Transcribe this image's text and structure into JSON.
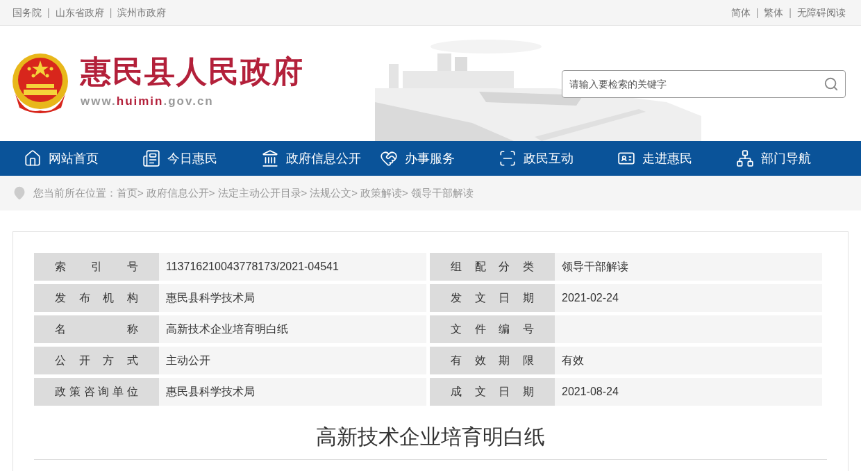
{
  "top_bar": {
    "left_links": [
      "国务院",
      "山东省政府",
      "滨州市政府"
    ],
    "right_links": [
      "简体",
      "繁体",
      "无障碍阅读"
    ],
    "separator": "|"
  },
  "header": {
    "title": "惠民县人民政府",
    "url_parts": [
      "www.",
      "huimin",
      ".gov.cn"
    ],
    "search": {
      "placeholder": "请输入要检索的关键字"
    }
  },
  "nav": [
    {
      "label": "网站首页"
    },
    {
      "label": "今日惠民"
    },
    {
      "label": "政府信息公开"
    },
    {
      "label": "办事服务"
    },
    {
      "label": "政民互动"
    },
    {
      "label": "走进惠民"
    },
    {
      "label": "部门导航"
    }
  ],
  "breadcrumb": {
    "prefix": "您当前所在位置：",
    "separator": ">",
    "items": [
      "首页",
      "政府信息公开",
      "法定主动公开目录",
      "法规公文",
      "政策解读",
      "领导干部解读"
    ]
  },
  "info_table": [
    [
      {
        "label": "索引号",
        "value": "113716210043778173/2021-04541"
      },
      {
        "label": "组配分类",
        "value": "领导干部解读"
      }
    ],
    [
      {
        "label": "发布机构",
        "value": "惠民县科学技术局"
      },
      {
        "label": "发文日期",
        "value": "2021-02-24"
      }
    ],
    [
      {
        "label": "名称",
        "value": "高新技术企业培育明白纸"
      },
      {
        "label": "文件编号"
      }
    ],
    [
      {
        "label": "公开方式",
        "value": "主动公开"
      },
      {
        "label": "有效期限",
        "value": "有效"
      }
    ],
    [
      {
        "label": "政策咨询单位",
        "value": "惠民县科学技术局"
      },
      {
        "label": "成文日期",
        "value": "2021-08-24"
      }
    ]
  ],
  "article": {
    "title": "高新技术企业培育明白纸"
  }
}
